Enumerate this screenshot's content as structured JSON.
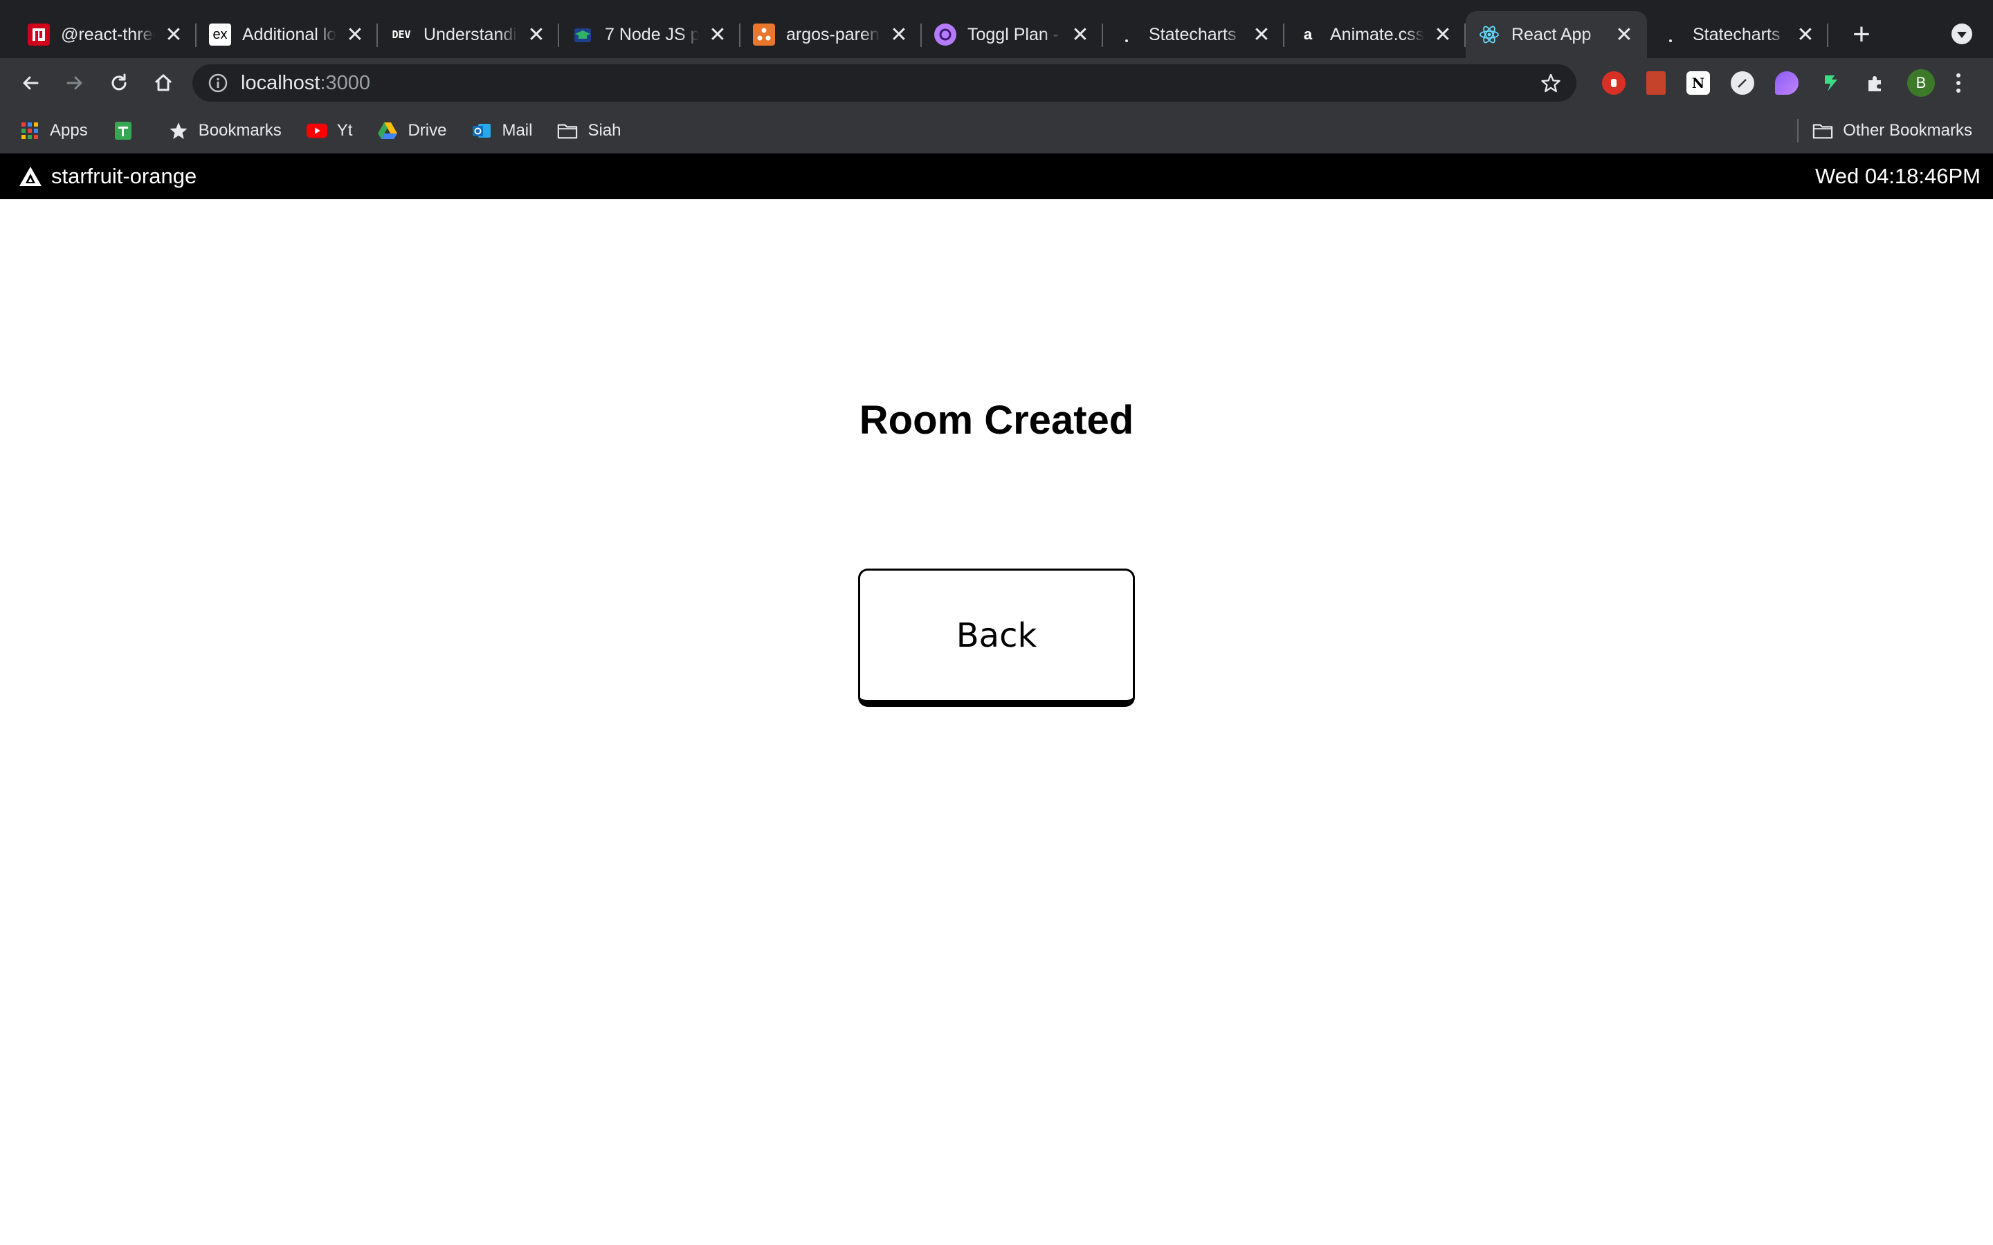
{
  "browser": {
    "tabs": [
      {
        "title": "@react-three",
        "favicon": "react-three-icon",
        "active": false
      },
      {
        "title": "Additional lo",
        "favicon": "ex-icon",
        "active": false
      },
      {
        "title": "Understandin",
        "favicon": "dev-icon",
        "active": false
      },
      {
        "title": "7 Node JS pr",
        "favicon": "graduation-cap-icon",
        "active": false
      },
      {
        "title": "argos-parent",
        "favicon": "argos-icon",
        "active": false
      },
      {
        "title": "Toggl Plan -",
        "favicon": "toggl-icon",
        "active": false
      },
      {
        "title": "Statecharts",
        "favicon": "statecharts-icon",
        "active": false
      },
      {
        "title": "Animate.css",
        "favicon": "animate-icon",
        "active": false
      },
      {
        "title": "React App",
        "favicon": "react-icon",
        "active": true
      },
      {
        "title": "Statecharts",
        "favicon": "statecharts-icon",
        "active": false
      }
    ],
    "favicon_text": {
      "ex": "ex",
      "dev": "DEV",
      "animate": "a"
    },
    "address": {
      "host": "localhost",
      "port": ":3000"
    },
    "profile_initial": "B",
    "bookmarks": [
      {
        "label": "Apps",
        "icon": "apps-grid-icon"
      },
      {
        "label": "",
        "icon": "sheets-icon"
      },
      {
        "label": "Bookmarks",
        "icon": "star-icon"
      },
      {
        "label": "Yt",
        "icon": "youtube-icon"
      },
      {
        "label": "Drive",
        "icon": "drive-icon"
      },
      {
        "label": "Mail",
        "icon": "outlook-icon"
      },
      {
        "label": "Siah",
        "icon": "folder-icon"
      }
    ],
    "other_bookmarks": "Other Bookmarks"
  },
  "app": {
    "brand": "starfruit-orange",
    "clock": "Wed 04:18:46PM"
  },
  "main": {
    "heading": "Room Created",
    "back_label": "Back"
  }
}
